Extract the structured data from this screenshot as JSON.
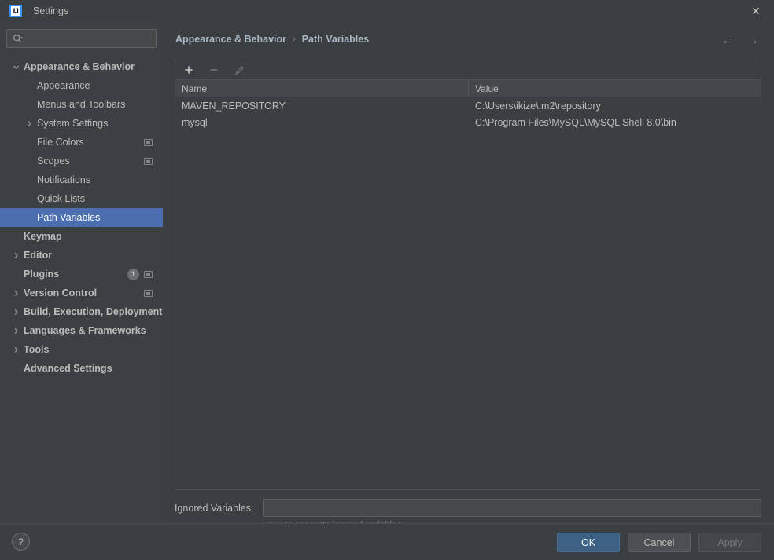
{
  "window": {
    "title": "Settings",
    "app_icon": "IJ",
    "close_icon": "✕"
  },
  "search": {
    "value": "",
    "placeholder": "",
    "icon": "search-icon"
  },
  "sidebar": {
    "items": [
      {
        "label": "Appearance & Behavior",
        "indent": 1,
        "arrow": "expanded",
        "bold": true
      },
      {
        "label": "Appearance",
        "indent": 2,
        "arrow": "none",
        "bold": false
      },
      {
        "label": "Menus and Toolbars",
        "indent": 2,
        "arrow": "none",
        "bold": false
      },
      {
        "label": "System Settings",
        "indent": 2,
        "arrow": "collapsed",
        "bold": false
      },
      {
        "label": "File Colors",
        "indent": 2,
        "arrow": "none",
        "bold": false,
        "badge": "square"
      },
      {
        "label": "Scopes",
        "indent": 2,
        "arrow": "none",
        "bold": false,
        "badge": "square"
      },
      {
        "label": "Notifications",
        "indent": 2,
        "arrow": "none",
        "bold": false
      },
      {
        "label": "Quick Lists",
        "indent": 2,
        "arrow": "none",
        "bold": false
      },
      {
        "label": "Path Variables",
        "indent": 2,
        "arrow": "none",
        "bold": false,
        "selected": true
      },
      {
        "label": "Keymap",
        "indent": 1,
        "arrow": "none",
        "bold": true
      },
      {
        "label": "Editor",
        "indent": 1,
        "arrow": "collapsed",
        "bold": true
      },
      {
        "label": "Plugins",
        "indent": 1,
        "arrow": "none",
        "bold": true,
        "badge": "square",
        "count": "1"
      },
      {
        "label": "Version Control",
        "indent": 1,
        "arrow": "collapsed",
        "bold": true,
        "badge": "square"
      },
      {
        "label": "Build, Execution, Deployment",
        "indent": 1,
        "arrow": "collapsed",
        "bold": true
      },
      {
        "label": "Languages & Frameworks",
        "indent": 1,
        "arrow": "collapsed",
        "bold": true
      },
      {
        "label": "Tools",
        "indent": 1,
        "arrow": "collapsed",
        "bold": true
      },
      {
        "label": "Advanced Settings",
        "indent": 1,
        "arrow": "none",
        "bold": true
      }
    ]
  },
  "main": {
    "breadcrumb": {
      "parent": "Appearance & Behavior",
      "separator": "›",
      "current": "Path Variables"
    },
    "nav": {
      "back_icon": "←",
      "forward_icon": "→"
    },
    "toolbar": {
      "add_label": "+",
      "remove_label": "−",
      "edit_label": "edit-pencil-icon"
    },
    "table": {
      "columns": [
        "Name",
        "Value"
      ],
      "rows": [
        {
          "name": "MAVEN_REPOSITORY",
          "value": "C:\\Users\\ikize\\.m2\\repository"
        },
        {
          "name": "mysql",
          "value": "C:\\Program Files\\MySQL\\MySQL Shell 8.0\\bin"
        }
      ]
    },
    "ignored": {
      "label": "Ignored Variables:",
      "value": "",
      "placeholder": "",
      "hint": "use ; to separate ignored variables"
    }
  },
  "footer": {
    "help_label": "?",
    "ok_label": "OK",
    "cancel_label": "Cancel",
    "apply_label": "Apply"
  },
  "colors": {
    "selection": "#4b6eaf",
    "primary_button": "#3d6185",
    "panel_bg": "#3c3f41",
    "sidebar_bg": "#3c4043",
    "text": "#bbbbbb",
    "breadcrumb_text": "#a9b7c6"
  }
}
